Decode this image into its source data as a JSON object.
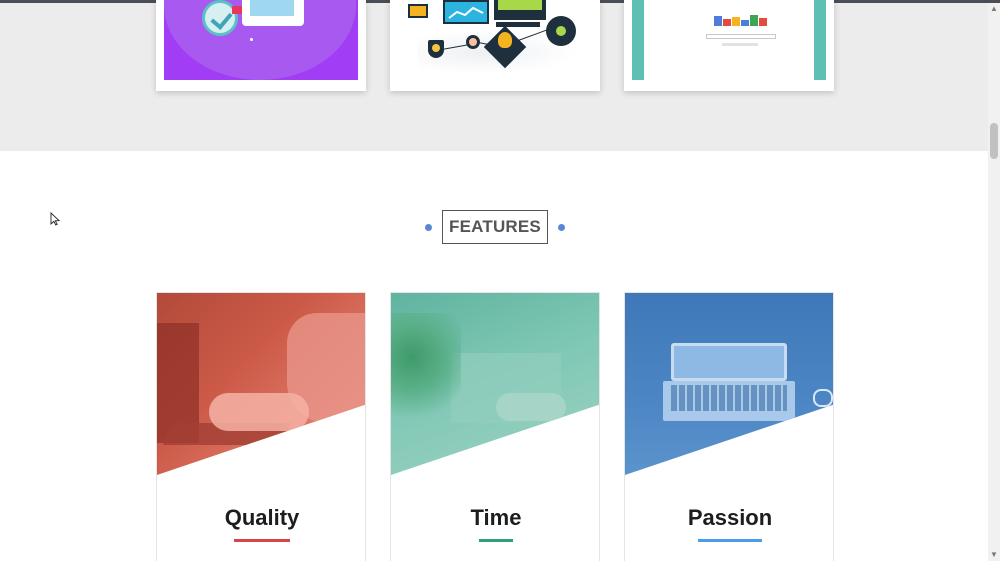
{
  "features_section": {
    "heading": "FEATURES",
    "accent_color": "#5b86d8",
    "cards": [
      {
        "title": "Quality",
        "underline_color": "#d9434a"
      },
      {
        "title": "Time",
        "underline_color": "#2f9e7a"
      },
      {
        "title": "Passion",
        "underline_color": "#4a9ee8"
      }
    ]
  },
  "top_cards": [
    {
      "icon": "check-screen-illustration",
      "bg_color": "#a03df5"
    },
    {
      "icon": "network-analytics-illustration",
      "bg_color": "#ffffff"
    },
    {
      "icon": "search-page-illustration",
      "bg_color": "#5ec0b4"
    }
  ],
  "colors": {
    "top_band": "#ececec",
    "page_bg": "#ffffff",
    "text": "#1d1d1d"
  }
}
